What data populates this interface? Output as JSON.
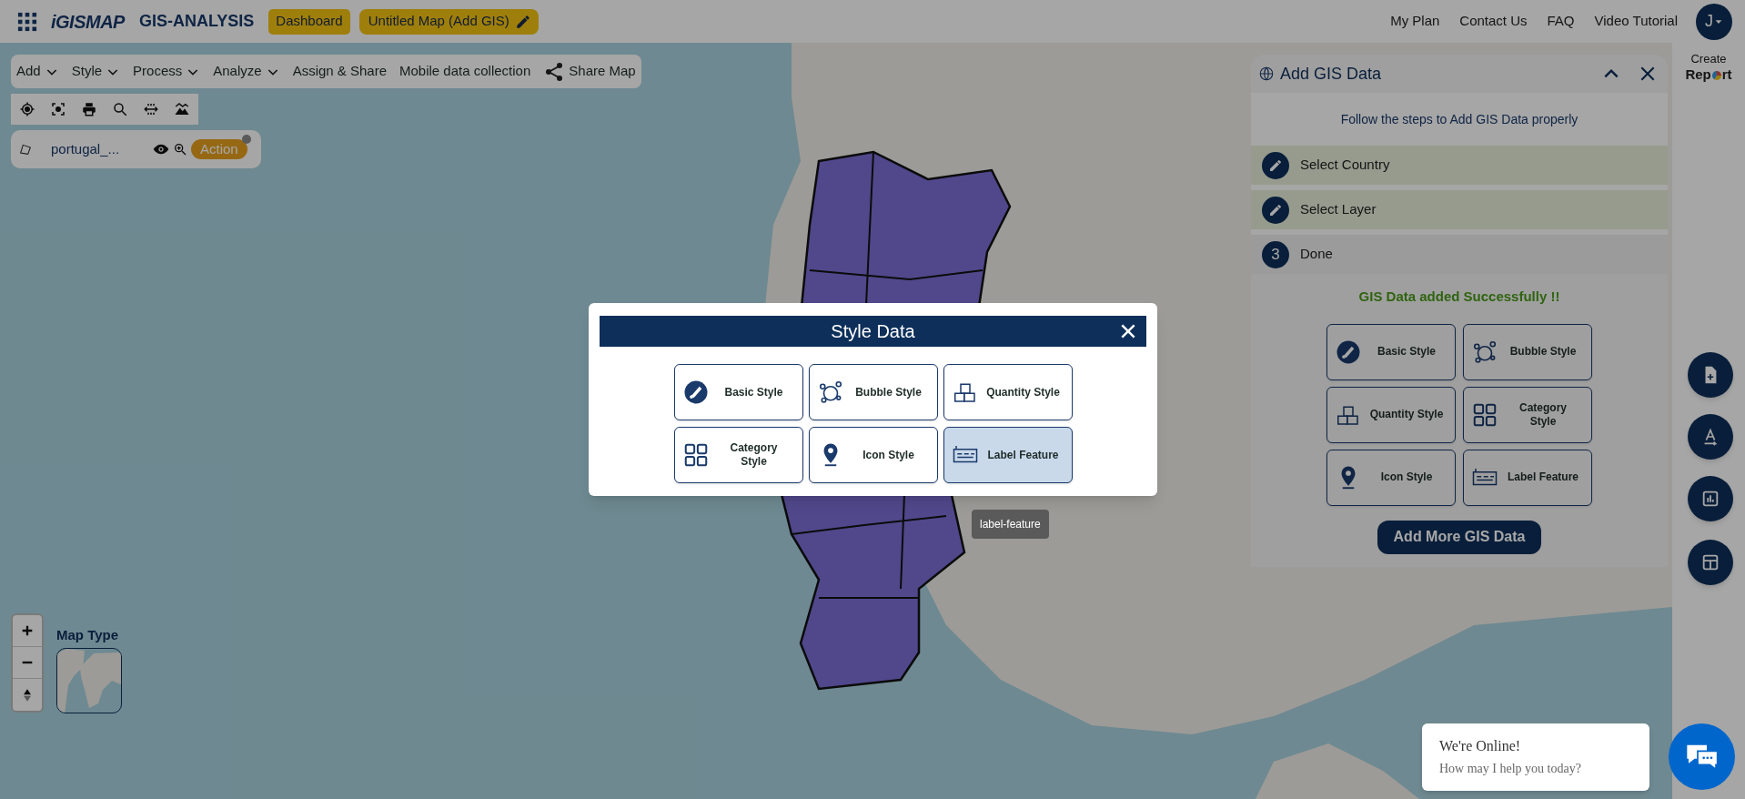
{
  "app": {
    "logo": "iGISMAP",
    "title": "GIS-ANALYSIS",
    "dashboard_button": "Dashboard",
    "map_button": "Untitled Map (Add GIS)"
  },
  "top_links": [
    "My Plan",
    "Contact Us",
    "FAQ",
    "Video Tutorial"
  ],
  "user": {
    "initial": "J"
  },
  "menu": [
    {
      "label": "Add",
      "dropdown": true
    },
    {
      "label": "Style",
      "dropdown": true
    },
    {
      "label": "Process",
      "dropdown": true
    },
    {
      "label": "Analyze",
      "dropdown": true
    },
    {
      "label": "Assign & Share",
      "dropdown": false
    },
    {
      "label": "Mobile data collection",
      "dropdown": false
    },
    {
      "label": "Share Map",
      "dropdown": false,
      "kind": "share"
    }
  ],
  "layer": {
    "name": "portugal_...",
    "action": "Action"
  },
  "map_type": {
    "label": "Map Type"
  },
  "create_report": {
    "label": "Create",
    "logo_start": "Rep",
    "logo_end": "rt"
  },
  "panel": {
    "title": "Add GIS Data",
    "intro": "Follow the steps to Add GIS Data properly",
    "steps": [
      {
        "kind": "edit",
        "label": "Select Country",
        "completed": true
      },
      {
        "kind": "edit",
        "label": "Select Layer",
        "completed": true
      },
      {
        "kind": "number",
        "number": "3",
        "label": "Done",
        "completed": false
      }
    ],
    "success": "GIS Data added Successfully !!",
    "styles": [
      {
        "kind": "basic",
        "label": "Basic Style"
      },
      {
        "kind": "bubble",
        "label": "Bubble Style"
      },
      {
        "kind": "quantity",
        "label": "Quantity Style"
      },
      {
        "kind": "category",
        "label": "Category Style"
      },
      {
        "kind": "icon",
        "label": "Icon Style"
      },
      {
        "kind": "label",
        "label": "Label Feature"
      }
    ],
    "add_more": "Add More GIS Data"
  },
  "modal": {
    "title": "Style Data",
    "options": [
      {
        "kind": "basic",
        "label": "Basic Style",
        "selected": false
      },
      {
        "kind": "bubble",
        "label": "Bubble Style",
        "selected": false
      },
      {
        "kind": "quantity",
        "label": "Quantity Style",
        "selected": false
      },
      {
        "kind": "category",
        "label": "Category Style",
        "selected": false
      },
      {
        "kind": "icon",
        "label": "Icon Style",
        "selected": false
      },
      {
        "kind": "label",
        "label": "Label Feature",
        "selected": true
      }
    ],
    "tooltip": "label-feature"
  },
  "chat": {
    "title": "We're Online!",
    "subtitle": "How may I help you today?"
  }
}
